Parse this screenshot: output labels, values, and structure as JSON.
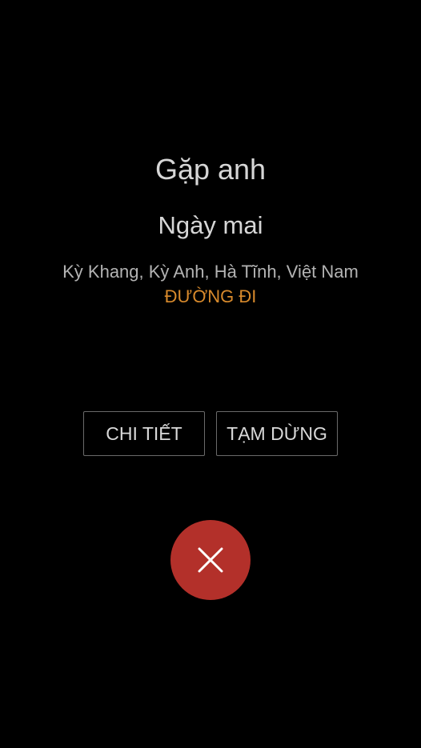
{
  "event": {
    "title": "Gặp anh",
    "time": "Ngày mai",
    "location": "Kỳ Khang, Kỳ Anh, Hà Tĩnh, Việt Nam",
    "directions_label": "ĐƯỜNG ĐI"
  },
  "actions": {
    "details_label": "CHI TIẾT",
    "snooze_label": "TẠM DỪNG"
  },
  "dismiss": {
    "icon": "close-icon",
    "color": "#b3302a"
  },
  "colors": {
    "background": "#000000",
    "accent": "#d88a2c"
  }
}
